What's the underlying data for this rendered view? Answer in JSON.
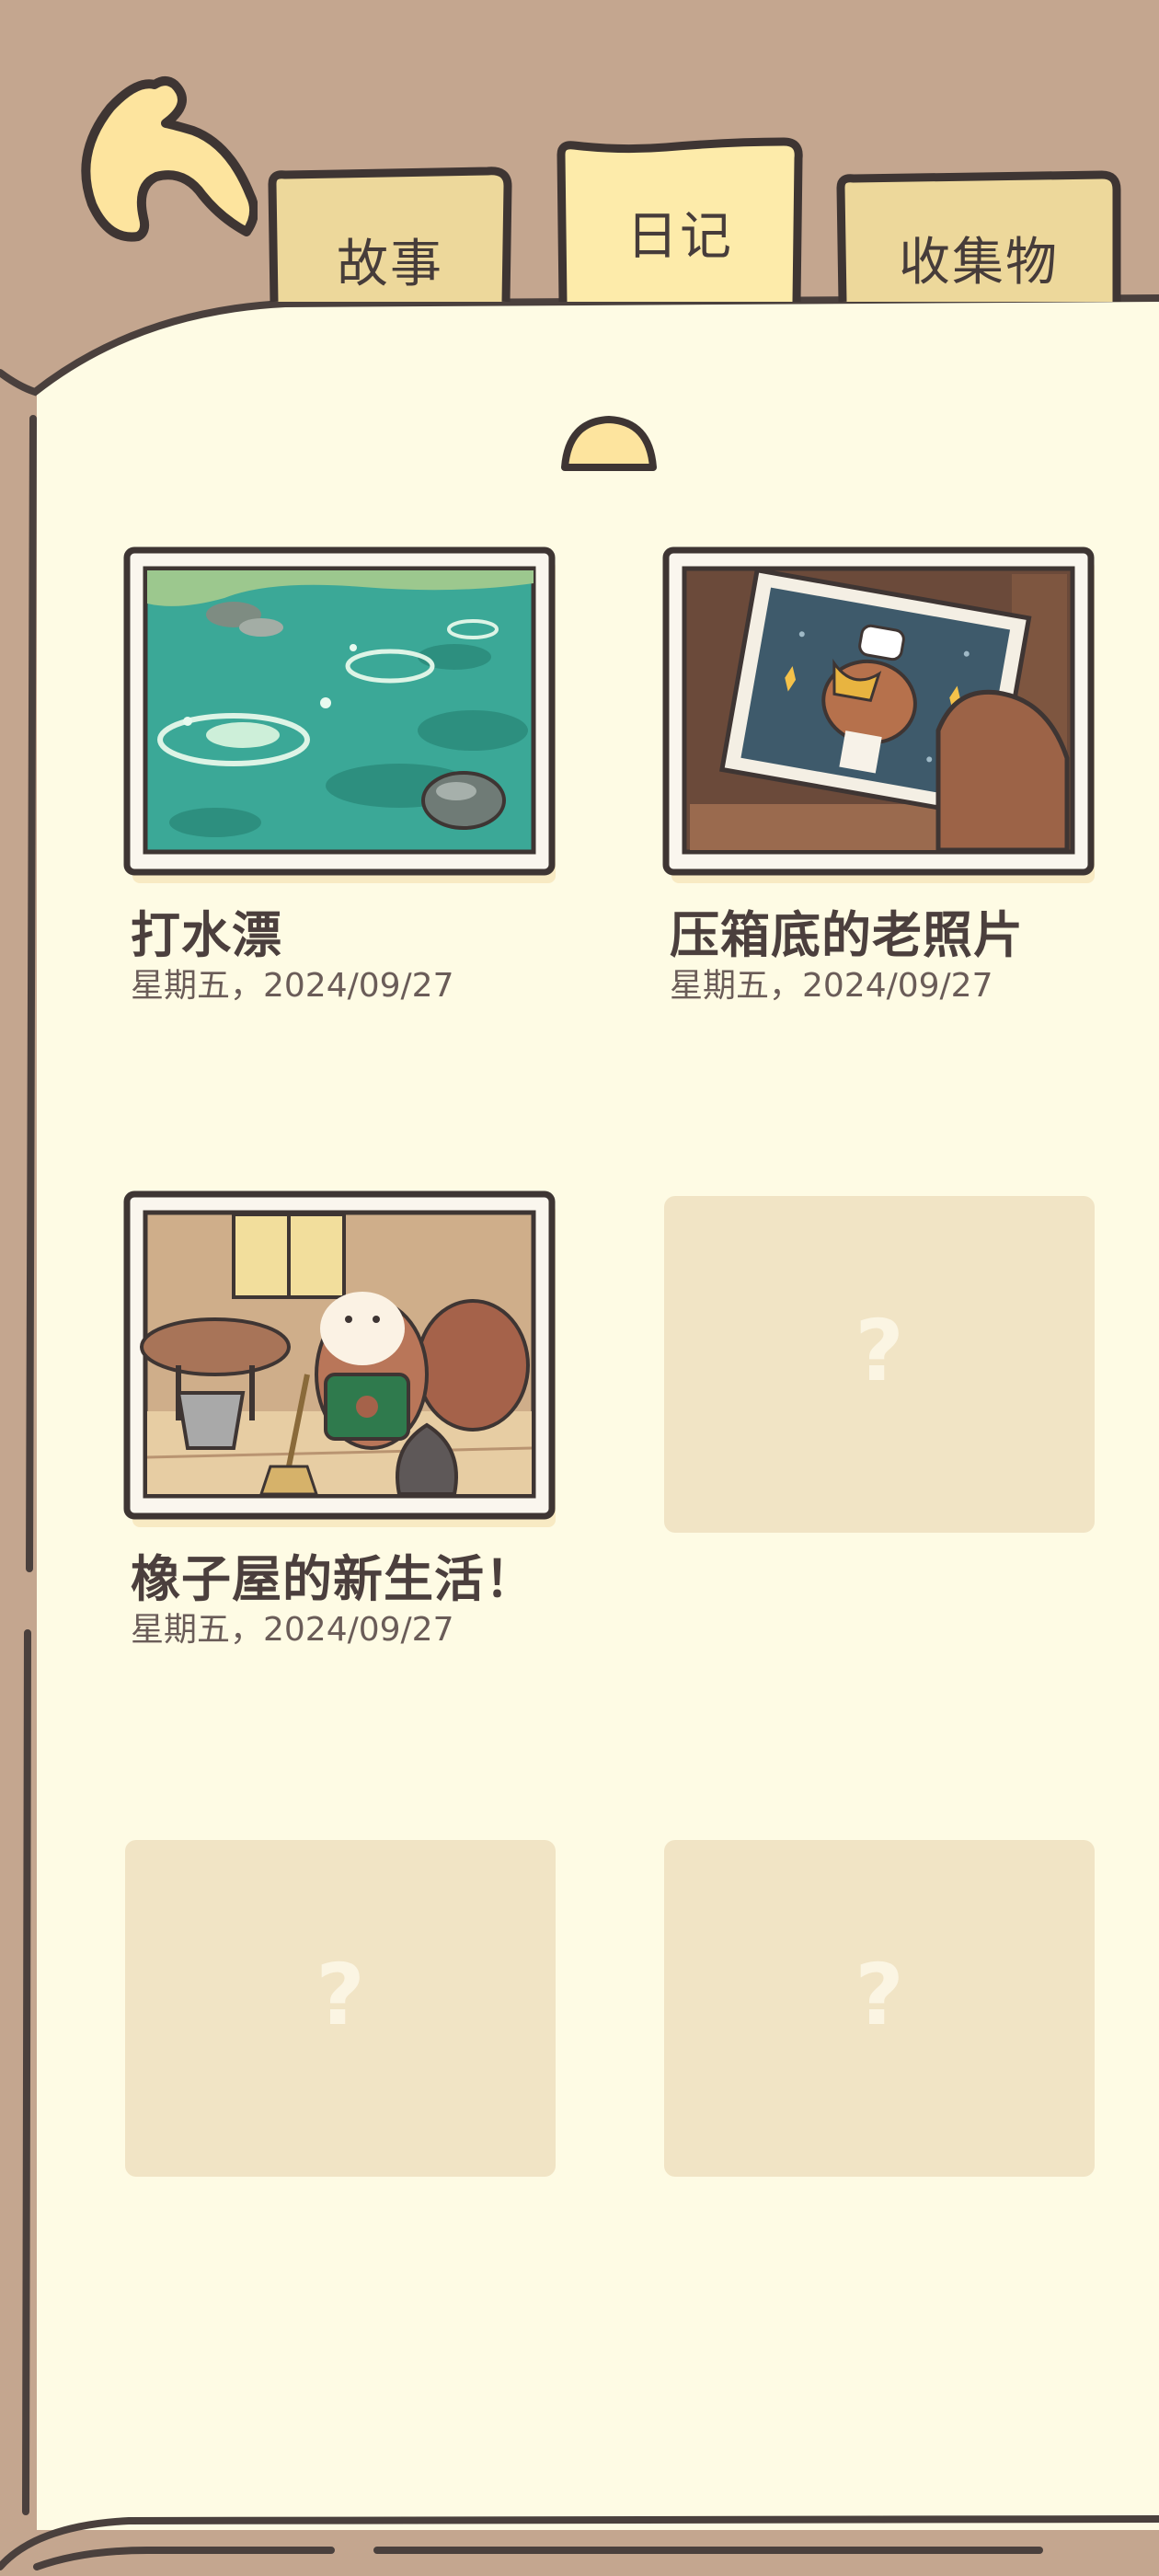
{
  "tabs": [
    {
      "label": "故事",
      "active": false
    },
    {
      "label": "日记",
      "active": true
    },
    {
      "label": "收集物",
      "active": false
    }
  ],
  "icons": {
    "back": "back-arrow-icon",
    "collapse": "chevron-up-icon",
    "locked": "question-mark-icon"
  },
  "entries": [
    {
      "title": "打水漂",
      "date": "星期五，2024/09/27",
      "image": "pond-stone-skipping"
    },
    {
      "title": "压箱底的老照片",
      "date": "星期五，2024/09/27",
      "image": "old-photo-of-chef-squirrel"
    },
    {
      "title": "橡子屋的新生活！",
      "date": "星期五，2024/09/27",
      "image": "squirrel-cleaning-house"
    }
  ],
  "locked_slots": [
    {
      "label": "?"
    },
    {
      "label": "?"
    },
    {
      "label": "?"
    }
  ],
  "colors": {
    "background": "#C4A68F",
    "page": "#FEFBE4",
    "outline": "#4A403D",
    "tab_inactive": "#EDD89B",
    "tab_active": "#FDEBAA",
    "locked_slot": "#F1E4C5"
  }
}
